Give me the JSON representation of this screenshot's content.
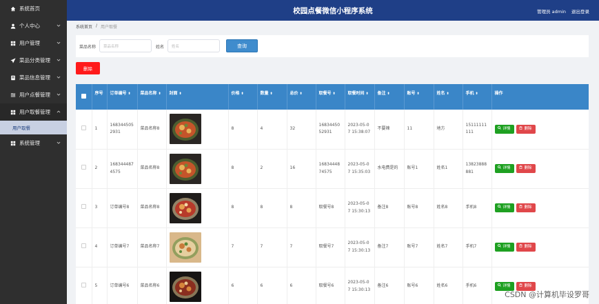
{
  "sidebar": {
    "items": [
      {
        "label": "系统首页",
        "icon": "home-icon"
      },
      {
        "label": "个人中心",
        "icon": "user-icon",
        "chevron": "down"
      },
      {
        "label": "用户管理",
        "icon": "grid-icon",
        "chevron": "down"
      },
      {
        "label": "菜品分类管理",
        "icon": "send-icon",
        "chevron": "down"
      },
      {
        "label": "菜品信息管理",
        "icon": "book-icon",
        "chevron": "down"
      },
      {
        "label": "用户点餐管理",
        "icon": "list-icon",
        "chevron": "down"
      },
      {
        "label": "用户取餐管理",
        "icon": "grid-icon",
        "chevron": "up"
      },
      {
        "label": "用户取餐",
        "icon": "",
        "sub": true
      },
      {
        "label": "系统管理",
        "icon": "grid-icon",
        "chevron": "down"
      }
    ]
  },
  "header": {
    "title": "校园点餐微信小程序系统",
    "admin": "管理员 admin",
    "logout": "退出登录"
  },
  "breadcrumb": {
    "home": "系统首页",
    "sep": "/",
    "current": "用户取餐"
  },
  "search": {
    "dish_label": "菜品名称",
    "dish_placeholder": "菜品名称",
    "name_label": "姓名",
    "name_placeholder": "姓名",
    "button": "查询"
  },
  "delete_button": "删除",
  "table": {
    "headers": [
      "",
      "序号",
      "订单编号",
      "菜品名称",
      "封面",
      "价格",
      "数量",
      "总价",
      "取餐号",
      "取餐时间",
      "备注",
      "账号",
      "姓名",
      "手机",
      "操作"
    ],
    "sortable": [
      false,
      false,
      true,
      true,
      true,
      true,
      true,
      true,
      true,
      true,
      true,
      true,
      true,
      true,
      false
    ],
    "rows": [
      {
        "idx": "1",
        "order": "1683445052931",
        "dish": "菜品名称8",
        "price": "8",
        "qty": "4",
        "total": "32",
        "pickup": "1683445052931",
        "time": "2023-05-07 15:38:07",
        "note": "不要辣",
        "account": "11",
        "name": "地方",
        "phone": "15111111111"
      },
      {
        "idx": "2",
        "order": "1683444874575",
        "dish": "菜品名称8",
        "price": "8",
        "qty": "2",
        "total": "16",
        "pickup": "1683444874575",
        "time": "2023-05-07 15:35:03",
        "note": "水电费是的",
        "account": "账号1",
        "name": "姓名1",
        "phone": "13823888881"
      },
      {
        "idx": "3",
        "order": "订单编号8",
        "dish": "菜品名称8",
        "price": "8",
        "qty": "8",
        "total": "8",
        "pickup": "取餐号8",
        "time": "2023-05-07 15:30:13",
        "note": "备注8",
        "account": "账号8",
        "name": "姓名8",
        "phone": "手机8"
      },
      {
        "idx": "4",
        "order": "订单编号7",
        "dish": "菜品名称7",
        "price": "7",
        "qty": "7",
        "total": "7",
        "pickup": "取餐号7",
        "time": "2023-05-07 15:30:13",
        "note": "备注7",
        "account": "账号7",
        "name": "姓名7",
        "phone": "手机7"
      },
      {
        "idx": "5",
        "order": "订单编号6",
        "dish": "菜品名称6",
        "price": "6",
        "qty": "6",
        "total": "6",
        "pickup": "取餐号6",
        "time": "2023-05-07 15:30:13",
        "note": "备注6",
        "account": "账号6",
        "name": "姓名6",
        "phone": "手机6"
      }
    ],
    "detail_label": "详情",
    "delete_label": "删除"
  },
  "watermark": "CSDN @计算机毕设罗哥",
  "colors": {
    "sidebar": "#2f2f2f",
    "header": "#1f3f87",
    "table_header": "#3a86c8",
    "search_button": "#3f8ccd",
    "delete_button": "#ff1a1a",
    "detail_button": "#1ea021",
    "row_delete_button": "#e0474a"
  }
}
